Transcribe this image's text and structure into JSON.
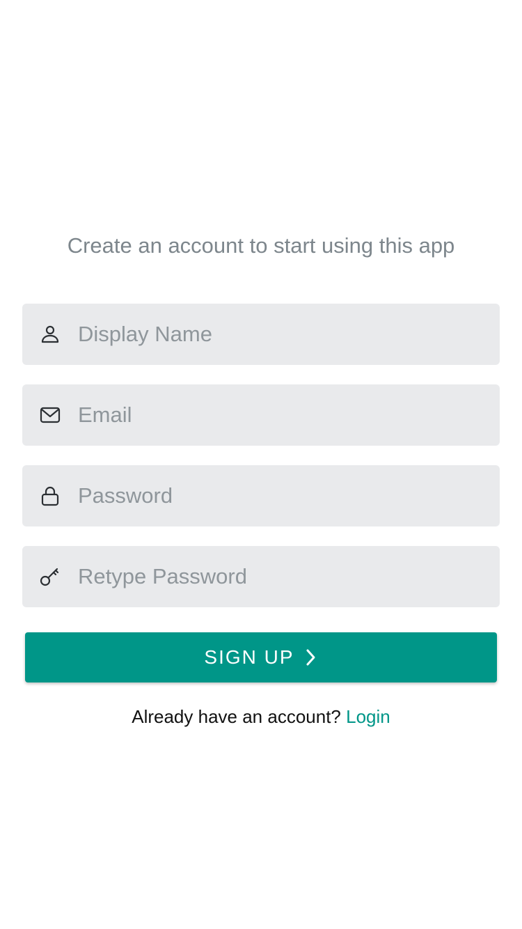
{
  "header": {
    "subtitle": "Create an account to start using this app"
  },
  "form": {
    "fields": [
      {
        "name": "display-name",
        "icon": "user-icon",
        "placeholder": "Display Name",
        "value": ""
      },
      {
        "name": "email",
        "icon": "mail-icon",
        "placeholder": "Email",
        "value": ""
      },
      {
        "name": "password",
        "icon": "lock-icon",
        "placeholder": "Password",
        "value": ""
      },
      {
        "name": "retype-password",
        "icon": "key-icon",
        "placeholder": "Retype Password",
        "value": ""
      }
    ],
    "submit_label": "SIGN UP",
    "submit_icon": "chevron-right-icon"
  },
  "footer": {
    "prompt": "Already have an account?",
    "link_label": "Login"
  },
  "colors": {
    "accent": "#009688",
    "field_bg": "#e9eaec",
    "subtitle": "#7d868c",
    "placeholder": "#8f969b"
  }
}
